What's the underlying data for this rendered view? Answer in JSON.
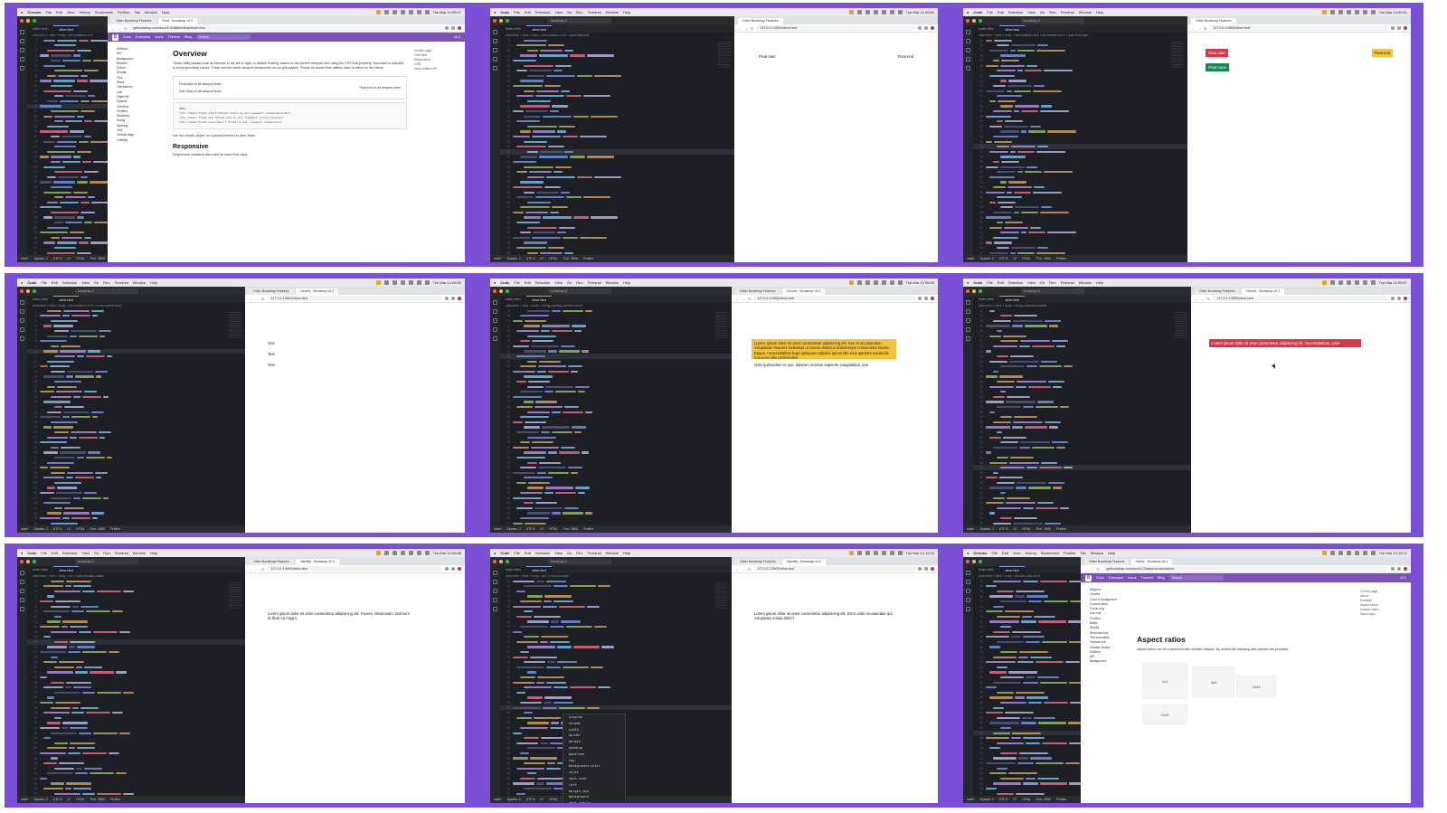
{
  "menubar": {
    "apps": [
      "Chrome",
      "Code",
      "Code",
      "Code",
      "Code",
      "Code",
      "Code",
      "Code",
      "Chrome"
    ],
    "menus": [
      "File",
      "Edit",
      "Selection",
      "View",
      "Go",
      "Run",
      "Terminal",
      "Window",
      "Help"
    ],
    "chrome_menus": [
      "File",
      "Edit",
      "View",
      "History",
      "Bookmarks",
      "Profiles",
      "Tab",
      "Window",
      "Help"
    ],
    "clocks": [
      "Tue Mar 14 09:47",
      "Tue Mar 14 09:50",
      "Tue Mar 14 09:51",
      "Tue Mar 14 09:52",
      "Tue Mar 14 09:55",
      "Tue Mar 14 09:57",
      "Tue Mar 14 09:58",
      "Tue Mar 14 10:10",
      "Tue Mar 14 10:12"
    ]
  },
  "vscode": {
    "search": "bootstrap-5",
    "tabs": [
      "index.html",
      "other.html"
    ],
    "crumbs": [
      "other.html > html > body > div.container.mt-5",
      "other.html > html > body > div.container.mt-5 > span.float-end",
      "other.html > html > body > div.container.mt-5 > div.clearfix.mb-3 > span.float-start",
      "other.html > html > body > div.container.mt-5 > p.user-select-none",
      "other.html > html > body > div.bg-warning.overflow-scroll",
      "other.html > html > body > div.bg-success.invisible",
      "other.html > html > body > div > span.visually-hidden",
      "other.html > html > body > div > p.text-truncate",
      "other.html > html > body > div.ratio.ratio-16x9"
    ],
    "status": {
      "branch": "main*",
      "spaces": "Spaces: 2",
      "encoding": "UTF-8",
      "eol": "LF",
      "lang": "HTML",
      "port": "Port : 5500",
      "prettier": "Prettier"
    },
    "autocomplete": [
      "display",
      "height",
      "width",
      "border",
      "margin",
      "padding",
      "position",
      "top",
      "background-color",
      "color",
      "font-size",
      "left",
      "margin-top",
      "background",
      "font-family"
    ]
  },
  "browser": {
    "tabs": [
      "Other Bootstrap Features",
      "Float · Bootstrap v5.3",
      "Clearfix · Bootstrap v5.3",
      "Visibility · Bootstrap v5.3",
      "Ratios · Bootstrap v5.3"
    ],
    "urls": [
      "getbootstrap.com/docs/5.3/utilities/float/#overview",
      "127.0.0.1:5500/other.html",
      "getbootstrap.com/docs/5.3/helpers/ratio/#about"
    ]
  },
  "docs": {
    "brand": "B",
    "nav": [
      "Docs",
      "Examples",
      "Icons",
      "Themes",
      "Blog"
    ],
    "search": "Search",
    "version": "v5.3",
    "sidebar_utilities": [
      "Utilities",
      "API",
      "Background",
      "Borders",
      "Colors",
      "Display",
      "Flex",
      "Float",
      "Interactions",
      "Link",
      "Object fit",
      "Opacity",
      "Overflow",
      "Position",
      "Shadows",
      "Sizing",
      "Spacing",
      "Text",
      "Vertical align",
      "Visibility"
    ],
    "overview_title": "Overview",
    "overview_text": "These utility classes float an element to the left or right, or disable floating, based on the current viewport size using the CSS float property. !important is included to avoid specificity issues. These use the same viewport breakpoints as our grid system. Please be aware float utilities have no effect on flex items.",
    "example_lines": [
      "Float start on all viewport sizes",
      "Float end on all viewport sizes",
      "Don't float on all viewport sizes"
    ],
    "code_lang": "HTML",
    "code_lines": [
      "<div class=\"float-start\">Float start on all viewport sizes</div><br>",
      "<div class=\"float-end\">Float end on all viewport sizes</div><br>",
      "<div class=\"float-none\">Don't float on all viewport sizes</div>"
    ],
    "clearfix_note": "Use the clearfix helper on a parent element to clear floats.",
    "responsive_title": "Responsive",
    "responsive_text": "Responsive variations also exist for each float value.",
    "toc_title": "On this page",
    "toc": [
      "Overview",
      "Responsive",
      "CSS",
      "Sass utilities API"
    ],
    "helpers_sidebar": [
      "Helpers",
      "Clearfix",
      "Color & background",
      "Colored links",
      "Focus ring",
      "Icon link",
      "Position",
      "Ratio",
      "Stacks",
      "Stretched link",
      "Text truncation",
      "Vertical rule",
      "Visually hidden",
      "Utilities",
      "API",
      "Background"
    ],
    "ratio_title": "Aspect ratios",
    "ratio_text": "Aspect ratios can be customized with modifier classes. By default the following ratio classes are provided:",
    "ratio_labels": [
      "1x1",
      "4x3",
      "16x9",
      "21x9"
    ],
    "ratio_toc": [
      "About",
      "Example",
      "Aspect ratios",
      "Custom ratios",
      "Sass maps"
    ]
  },
  "preview": {
    "float_start": "Float start",
    "float_end": "Float end",
    "float_none": "Float none",
    "text_items": [
      "Text",
      "Text",
      "Text"
    ],
    "lorem_warning": "Lorem, ipsum dolor sit amet consectetur adipisicing elit. Iure et accusantium voluptatum maiores molestias ut harum delectus doloremque consectetur facere. Eaque, necessitatibus fuga quisquam adipisci ipsum iste eius aperiam reiciendis non sunt odio perferendis!",
    "lorem_warning_tail": "Odio quibusdam et quo, dolorum incidunt sapiente voluptatibus, iure",
    "lorem_danger": "Lorem ipsum dolor sit amet consectetur adipisicing elit. Necessitatibus, quia!",
    "lorem_hidden": "Lorem ipsum dolor sit amet consectetur adipisicing elit. Facere, laboriosam. Dolorum at illum ea magni.",
    "lorem_truncate": "Lorem ipsum dolor sit amet consectetur adipisicing elit. Error unde recusandae qui, voluptates soluta dolor?"
  },
  "colors": {
    "purple_bg": "#7b4fd6",
    "bs_purple": "#7952b3",
    "warning": "#f4c33a",
    "danger": "#dc3545",
    "success": "#198754"
  }
}
